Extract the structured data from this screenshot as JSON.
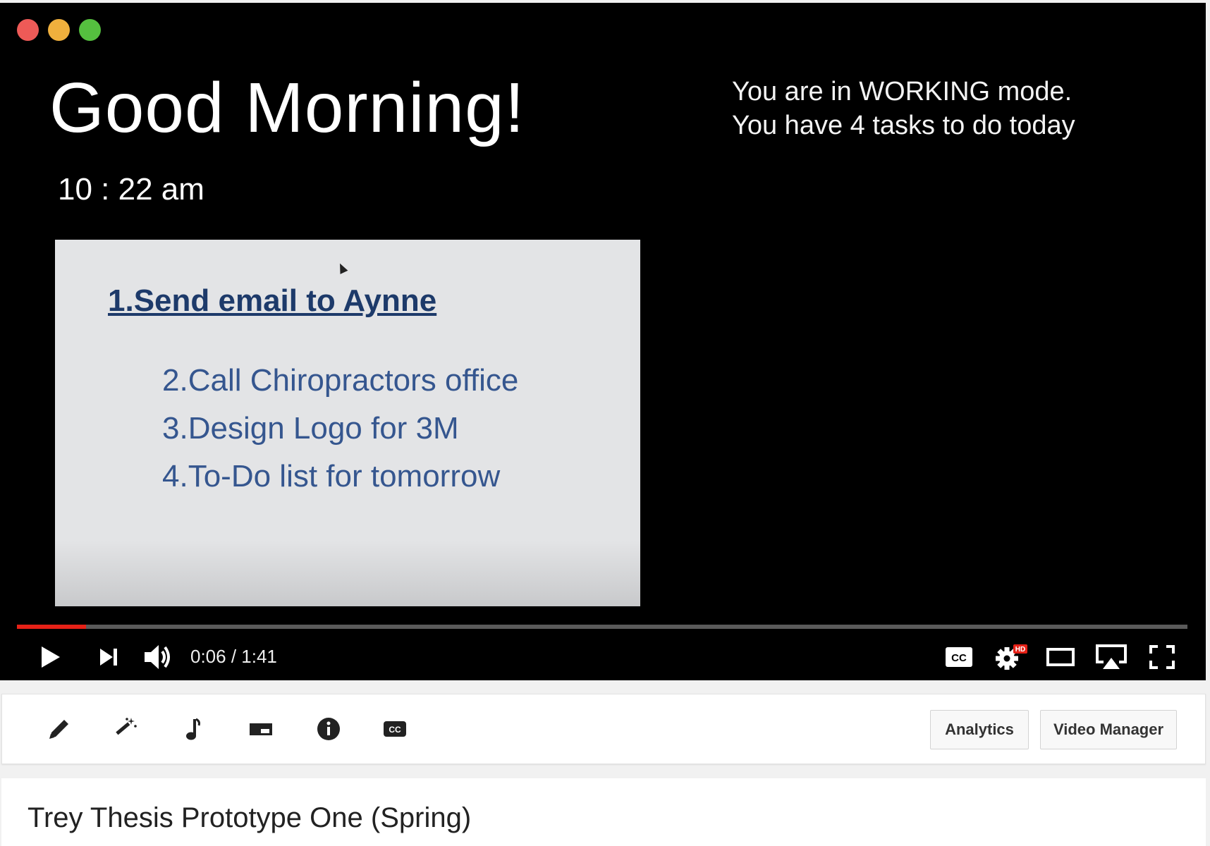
{
  "slide": {
    "greeting": "Good Morning!",
    "clock": "10 : 22 am",
    "mode_line1": "You are in WORKING mode.",
    "mode_line2": "You have 4 tasks to do today",
    "tasks": [
      "1.Send email to Aynne",
      "2.Call Chiropractors office",
      "3.Design Logo for 3M",
      "4.To-Do list for tomorrow"
    ]
  },
  "player": {
    "current_time": "0:06",
    "separator": " / ",
    "duration": "1:41",
    "progress": 0.059,
    "accent_color": "#e62117",
    "hd_badge": "HD",
    "cc_label": "CC"
  },
  "toolbar": {
    "icons": [
      "pencil-icon",
      "magic-wand-icon",
      "music-note-icon",
      "card-icon",
      "info-icon",
      "captions-icon"
    ],
    "analytics_label": "Analytics",
    "video_manager_label": "Video Manager"
  },
  "video": {
    "title": "Trey Thesis Prototype One (Spring)"
  }
}
